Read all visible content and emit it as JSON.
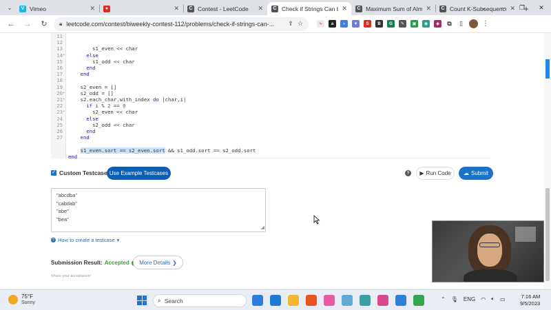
{
  "browser": {
    "tabs": [
      {
        "title": "Vimeo",
        "icon": "vimeo-icon",
        "color": "#1ab7ea",
        "glyph": "V",
        "active": false
      },
      {
        "title": "",
        "icon": "recording-icon",
        "color": "#d93025",
        "glyph": "●",
        "active": false
      },
      {
        "title": "Contest - LeetCode",
        "icon": "leetcode-icon",
        "color": "#555555",
        "glyph": "C",
        "active": false
      },
      {
        "title": "Check if Strings Can be",
        "icon": "leetcode-icon",
        "color": "#555555",
        "glyph": "C",
        "active": true
      },
      {
        "title": "Maximum Sum of Almo",
        "icon": "leetcode-icon",
        "color": "#555555",
        "glyph": "C",
        "active": false
      },
      {
        "title": "Count K-Subsequences",
        "icon": "leetcode-icon",
        "color": "#555555",
        "glyph": "C",
        "active": false
      }
    ],
    "url": "leetcode.com/contest/biweekly-contest-112/problems/check-if-strings-can-..."
  },
  "editor": {
    "lines": [
      {
        "n": "11",
        "fold": "",
        "html": "        s1_even << char"
      },
      {
        "n": "12",
        "fold": "",
        "html": "      <span class='kw'>else</span>"
      },
      {
        "n": "13",
        "fold": "▾",
        "html": "        s1_odd << char"
      },
      {
        "n": "14",
        "fold": "",
        "html": "      <span class='kw'>end</span>"
      },
      {
        "n": "15",
        "fold": "",
        "html": "    <span class='kw'>end</span>"
      },
      {
        "n": "16",
        "fold": "",
        "html": ""
      },
      {
        "n": "17",
        "fold": "",
        "html": "    s2_even = []"
      },
      {
        "n": "18",
        "fold": "",
        "html": "    s2_odd = []"
      },
      {
        "n": "19",
        "fold": "▾",
        "html": "    s2.each_char.with_index <span class='kw'>do</span> |char,i|"
      },
      {
        "n": "20",
        "fold": "▾",
        "html": "      <span class='kw'>if</span> i % <span class='num'>2</span> == <span class='num'>0</span>"
      },
      {
        "n": "21",
        "fold": "",
        "html": "        s2_even << char"
      },
      {
        "n": "22",
        "fold": "▾",
        "html": "      <span class='kw'>else</span>"
      },
      {
        "n": "23",
        "fold": "",
        "html": "        s2_odd << char"
      },
      {
        "n": "24",
        "fold": "",
        "html": "      <span class='kw'>end</span>"
      },
      {
        "n": "25",
        "fold": "",
        "html": "    <span class='kw'>end</span>"
      },
      {
        "n": "26",
        "fold": "",
        "html": ""
      },
      {
        "n": "27",
        "fold": "",
        "html": "    <span class='sel'>s1_even.sort == s2_even.sort</span> && s1_odd.sort == s2_odd.sort"
      },
      {
        "n": "",
        "fold": "",
        "html": "<span class='kw'>end</span>"
      },
      {
        "n": "",
        "fold": "",
        "html": ""
      }
    ]
  },
  "testcase_bar": {
    "label": "Custom Testcase",
    "example_button": "Use Example Testcases",
    "run_label": "Run Code",
    "submit_label": "Submit"
  },
  "testcase_input": [
    "\"abcdba\"",
    "\"cabdab\"",
    "\"abe\"",
    "\"bea\""
  ],
  "howto": "How to create a testcase",
  "submission": {
    "label": "Submission Result:",
    "status": "Accepted",
    "more": "More Details",
    "share": "Share your acceptance!"
  },
  "taskbar": {
    "temp": "75°F",
    "weather": "Sunny",
    "search_placeholder": "Search",
    "lang": "ENG",
    "time": "7:16 AM",
    "date": "9/5/2023",
    "icons": [
      {
        "name": "copilot-icon",
        "color": "#2d7de0"
      },
      {
        "name": "vscode-icon",
        "color": "#1f7ad6"
      },
      {
        "name": "file-explorer-icon",
        "color": "#f2b631"
      },
      {
        "name": "ubuntu-icon",
        "color": "#e95420"
      },
      {
        "name": "itunes-icon",
        "color": "#e85aa3"
      },
      {
        "name": "photos-icon",
        "color": "#62a8d8"
      },
      {
        "name": "notepad-icon",
        "color": "#3aa0a8"
      },
      {
        "name": "snipping-tool-icon",
        "color": "#d94a8c"
      },
      {
        "name": "onedrive-icon",
        "color": "#2f7fd8"
      },
      {
        "name": "chrome-icon",
        "color": "#34a853"
      }
    ]
  }
}
